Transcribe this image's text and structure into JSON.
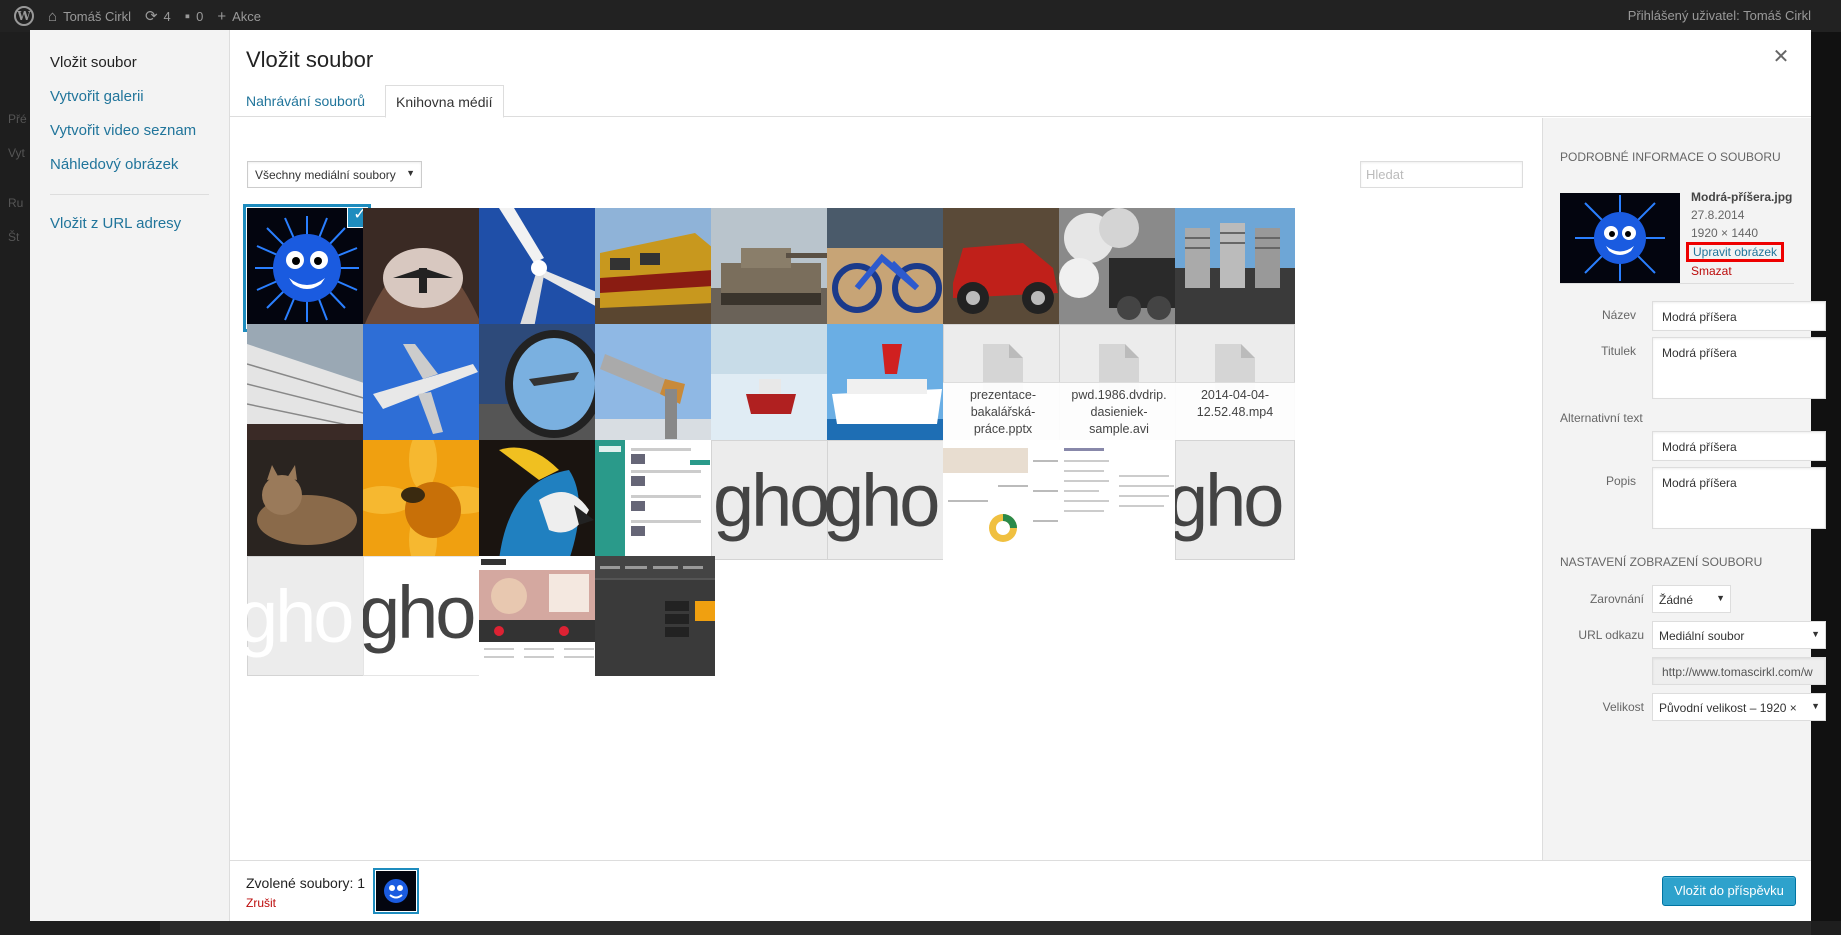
{
  "adminbar": {
    "site_name": "Tomáš Cirkl",
    "updates_count": "4",
    "comments_count": "0",
    "new_label": "Akce",
    "user_greeting": "Přihlášený uživatel: Tomáš Cirkl"
  },
  "backdrop_menu": [
    "Přé",
    "Vyt",
    "Ru",
    "Št"
  ],
  "menu": {
    "items": [
      "Vložit soubor",
      "Vytvořit galerii",
      "Vytvořit video seznam",
      "Náhledový obrázek",
      "Vložit z URL adresy"
    ]
  },
  "frame_title": "Vložit soubor",
  "router": {
    "tabs": [
      "Nahrávání souborů",
      "Knihovna médií"
    ]
  },
  "toolbar": {
    "filter_value": "Všechny mediální soubory",
    "search_placeholder": "Hledat"
  },
  "attachments": {
    "files": [
      {
        "name": "prezentace-bakalářská-práce.pptx",
        "l1": "prezentace-",
        "l2": "bakalářská-",
        "l3": "práce.pptx"
      },
      {
        "name": "pwd.1986.dvdrip.dasieniek-sample.avi",
        "l1": "pwd.1986.dvdrip.",
        "l2": "dasieniek-",
        "l3": "sample.avi"
      },
      {
        "name": "2014-04-04-12.52.48.mp4",
        "l1": "",
        "l2": "2014-04-04-",
        "l3": "12.52.48.mp4"
      }
    ],
    "ghost_text": "gho",
    "ghost_text2": "gho"
  },
  "details": {
    "heading": "Podrobné informace o souboru",
    "filename": "Modrá-příšera.jpg",
    "date": "27.8.2014",
    "dimensions": "1920 × 1440",
    "edit_label": "Upravit obrázek",
    "delete_label": "Smazat",
    "fields": {
      "name_label": "Název",
      "name_value": "Modrá příšera",
      "caption_label": "Titulek",
      "caption_value": "Modrá příšera",
      "alt_label": "Alternativní text",
      "alt_value": "Modrá příšera",
      "desc_label": "Popis",
      "desc_value": "Modrá příšera"
    }
  },
  "display_settings": {
    "heading": "Nastavení zobrazení souboru",
    "align_label": "Zarovnání",
    "align_value": "Žádné",
    "link_label": "URL odkazu",
    "link_value": "Mediální soubor",
    "link_url": "http://www.tomascirkl.com/w",
    "size_label": "Velikost",
    "size_value": "Původní velikost – 1920 ×"
  },
  "bottom": {
    "selected_label": "Zvolené soubory: 1",
    "clear_label": "Zrušit",
    "insert_label": "Vložit do příspěvku"
  }
}
